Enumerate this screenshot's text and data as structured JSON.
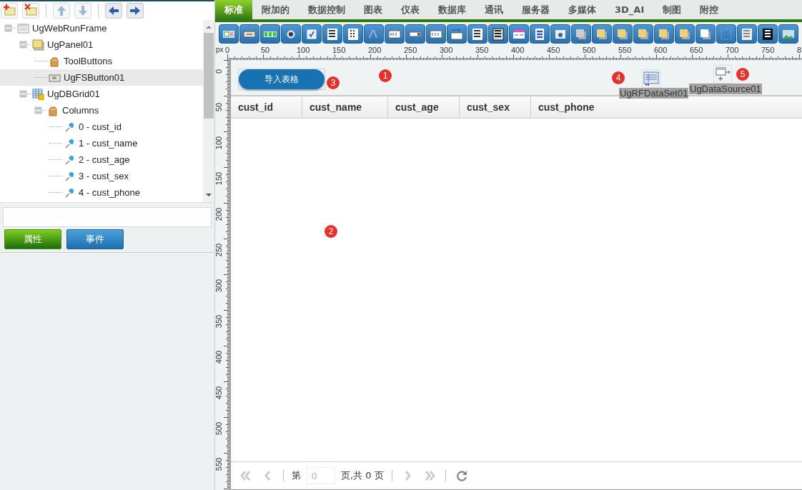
{
  "tree": {
    "items": [
      {
        "label": "UgWebRunFrame",
        "kind": "frame",
        "expanded": true,
        "selected": false,
        "children": [
          {
            "label": "UgPanel01",
            "kind": "panel",
            "expanded": true,
            "selected": false,
            "children": [
              {
                "label": "ToolButtons",
                "kind": "folder",
                "selected": false
              },
              {
                "label": "UgFSButton01",
                "kind": "button",
                "selected": true
              }
            ]
          },
          {
            "label": "UgDBGrid01",
            "kind": "grid",
            "expanded": true,
            "selected": false,
            "children": [
              {
                "label": "Columns",
                "kind": "folder",
                "expanded": true,
                "selected": false,
                "children": [
                  {
                    "label": "0 - cust_id",
                    "kind": "column",
                    "selected": false
                  },
                  {
                    "label": "1 - cust_name",
                    "kind": "column",
                    "selected": false
                  },
                  {
                    "label": "2 - cust_age",
                    "kind": "column",
                    "selected": false
                  },
                  {
                    "label": "3 - cust_sex",
                    "kind": "column",
                    "selected": false
                  },
                  {
                    "label": "4 - cust_phone",
                    "kind": "column",
                    "selected": false
                  }
                ]
              }
            ]
          }
        ]
      }
    ]
  },
  "inspector_tabs": [
    {
      "label": "属性",
      "selected": true
    },
    {
      "label": "事件",
      "selected": false
    }
  ],
  "palette_tabs": [
    {
      "label": "标准",
      "selected": true
    },
    {
      "label": "附加的",
      "selected": false
    },
    {
      "label": "数据控制",
      "selected": false
    },
    {
      "label": "图表",
      "selected": false
    },
    {
      "label": "仪表",
      "selected": false
    },
    {
      "label": "数据库",
      "selected": false
    },
    {
      "label": "通讯",
      "selected": false
    },
    {
      "label": "服务器",
      "selected": false
    },
    {
      "label": "多媒体",
      "selected": false
    },
    {
      "label": "3D_AI",
      "selected": false
    },
    {
      "label": "制图",
      "selected": false
    },
    {
      "label": "附控",
      "selected": false
    }
  ],
  "ruler": {
    "unit": "px",
    "x_labels": [
      "0",
      "50",
      "100",
      "150",
      "200",
      "250",
      "300",
      "350",
      "400",
      "450",
      "500",
      "550",
      "600",
      "650",
      "700",
      "750",
      "8"
    ],
    "y_labels": [
      "0",
      "50",
      "100",
      "150",
      "200",
      "250",
      "300",
      "350",
      "400",
      "450",
      "500",
      "550"
    ]
  },
  "canvas": {
    "panel_badge": "1",
    "button": {
      "label": "导入表格",
      "badge": "3"
    },
    "components": [
      {
        "label": "UgRFDataSet01",
        "kind": "dataset",
        "badge": "4"
      },
      {
        "label": "UgDataSource01",
        "kind": "datasource",
        "badge": "5"
      }
    ],
    "grid": {
      "badge": "2",
      "columns": [
        "cust_id",
        "cust_name",
        "cust_age",
        "cust_sex",
        "cust_phone"
      ],
      "pager": {
        "page_label": "第",
        "page_value": "0",
        "total_label": "页,共 0 页"
      }
    }
  }
}
